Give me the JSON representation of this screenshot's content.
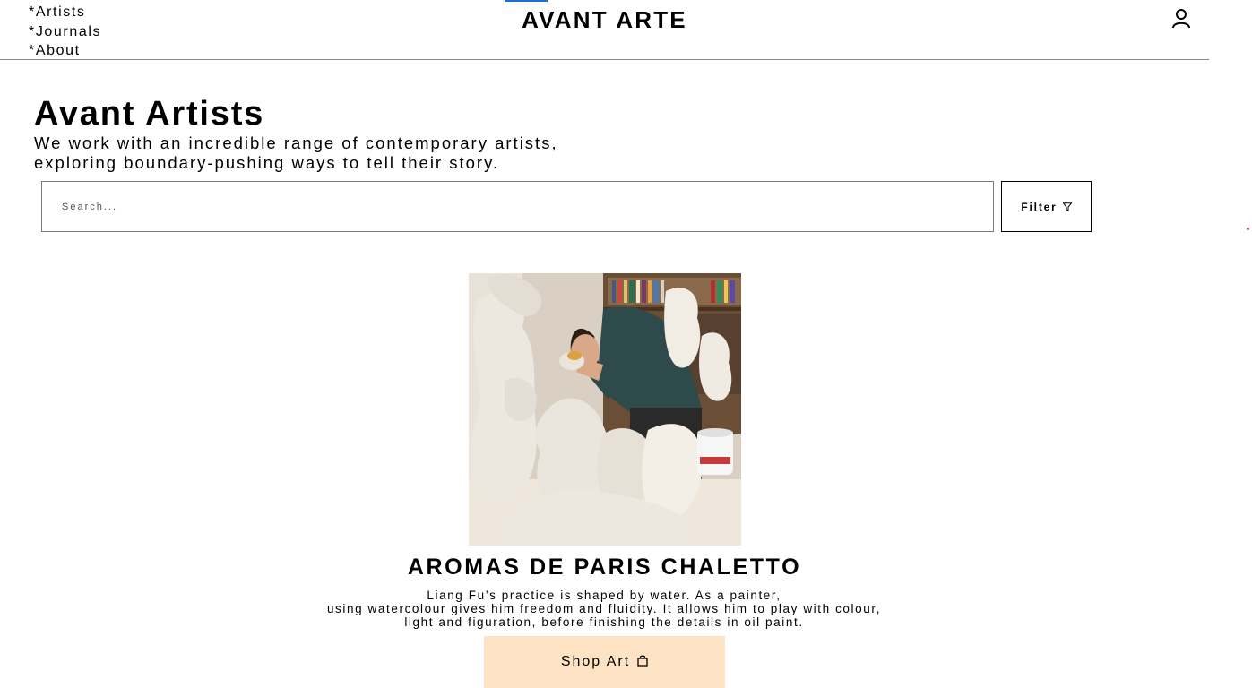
{
  "header": {
    "brand": "AVANT ARTE",
    "nav": [
      {
        "label": "*Artists"
      },
      {
        "label": "*Journals"
      },
      {
        "label": "*About"
      }
    ],
    "user_icon": "user-icon"
  },
  "intro": {
    "title": "Avant Artists",
    "subtitle_line1": "We work with an incredible range of contemporary artists,",
    "subtitle_line2": "exploring boundary-pushing ways to tell their story."
  },
  "search": {
    "placeholder": "Search...",
    "filter_label": "Filter",
    "filter_icon": "filter-icon"
  },
  "card": {
    "title": "AROMAS DE PARIS CHALETTO",
    "description": [
      "Liang Fu’s practice is shaped by water. As a painter,",
      "using watercolour gives him freedom and fluidity. It allows him to play with colour,",
      "light and figuration, before finishing the details in oil paint."
    ],
    "button_label": "Shop Art",
    "button_icon": "shopping-bag-icon",
    "button_color": "#fde3c3"
  },
  "colors": {
    "accent_tab": "#1f6fd1",
    "divider": "#8a8a8a"
  }
}
